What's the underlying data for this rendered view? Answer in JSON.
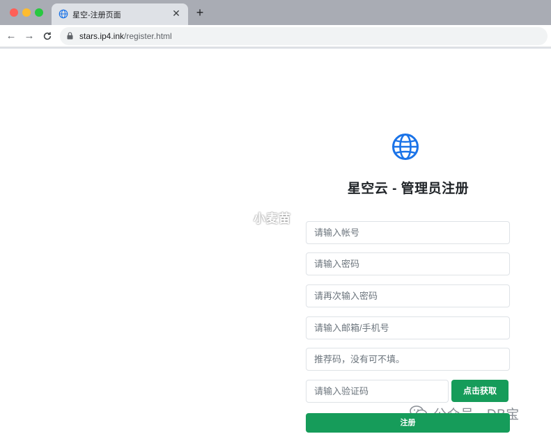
{
  "browser": {
    "tab_title": "星空-注册页面",
    "tab_close": "✕",
    "new_tab": "+",
    "back": "←",
    "forward": "→",
    "reload": "C",
    "url_host": "stars.ip4.ink",
    "url_path": "/register.html"
  },
  "page": {
    "title": "星空云 - 管理员注册",
    "watermark": "小麦苗",
    "form": {
      "account_placeholder": "请输入帐号",
      "password_placeholder": "请输入密码",
      "password_confirm_placeholder": "请再次输入密码",
      "email_phone_placeholder": "请输入邮箱/手机号",
      "referral_placeholder": "推荐码，没有可不填。",
      "code_placeholder": "请输入验证码",
      "get_code_label": "点击获取",
      "register_label": "注册"
    },
    "wechat_watermark": "公众号 · DB宝"
  },
  "colors": {
    "accent_green": "#169c5a",
    "globe_blue": "#1a73e8"
  },
  "icons": {
    "logo": "globe-icon",
    "tab_favicon": "globe-icon",
    "security": "lock-icon",
    "watermark": "wechat-icon"
  }
}
